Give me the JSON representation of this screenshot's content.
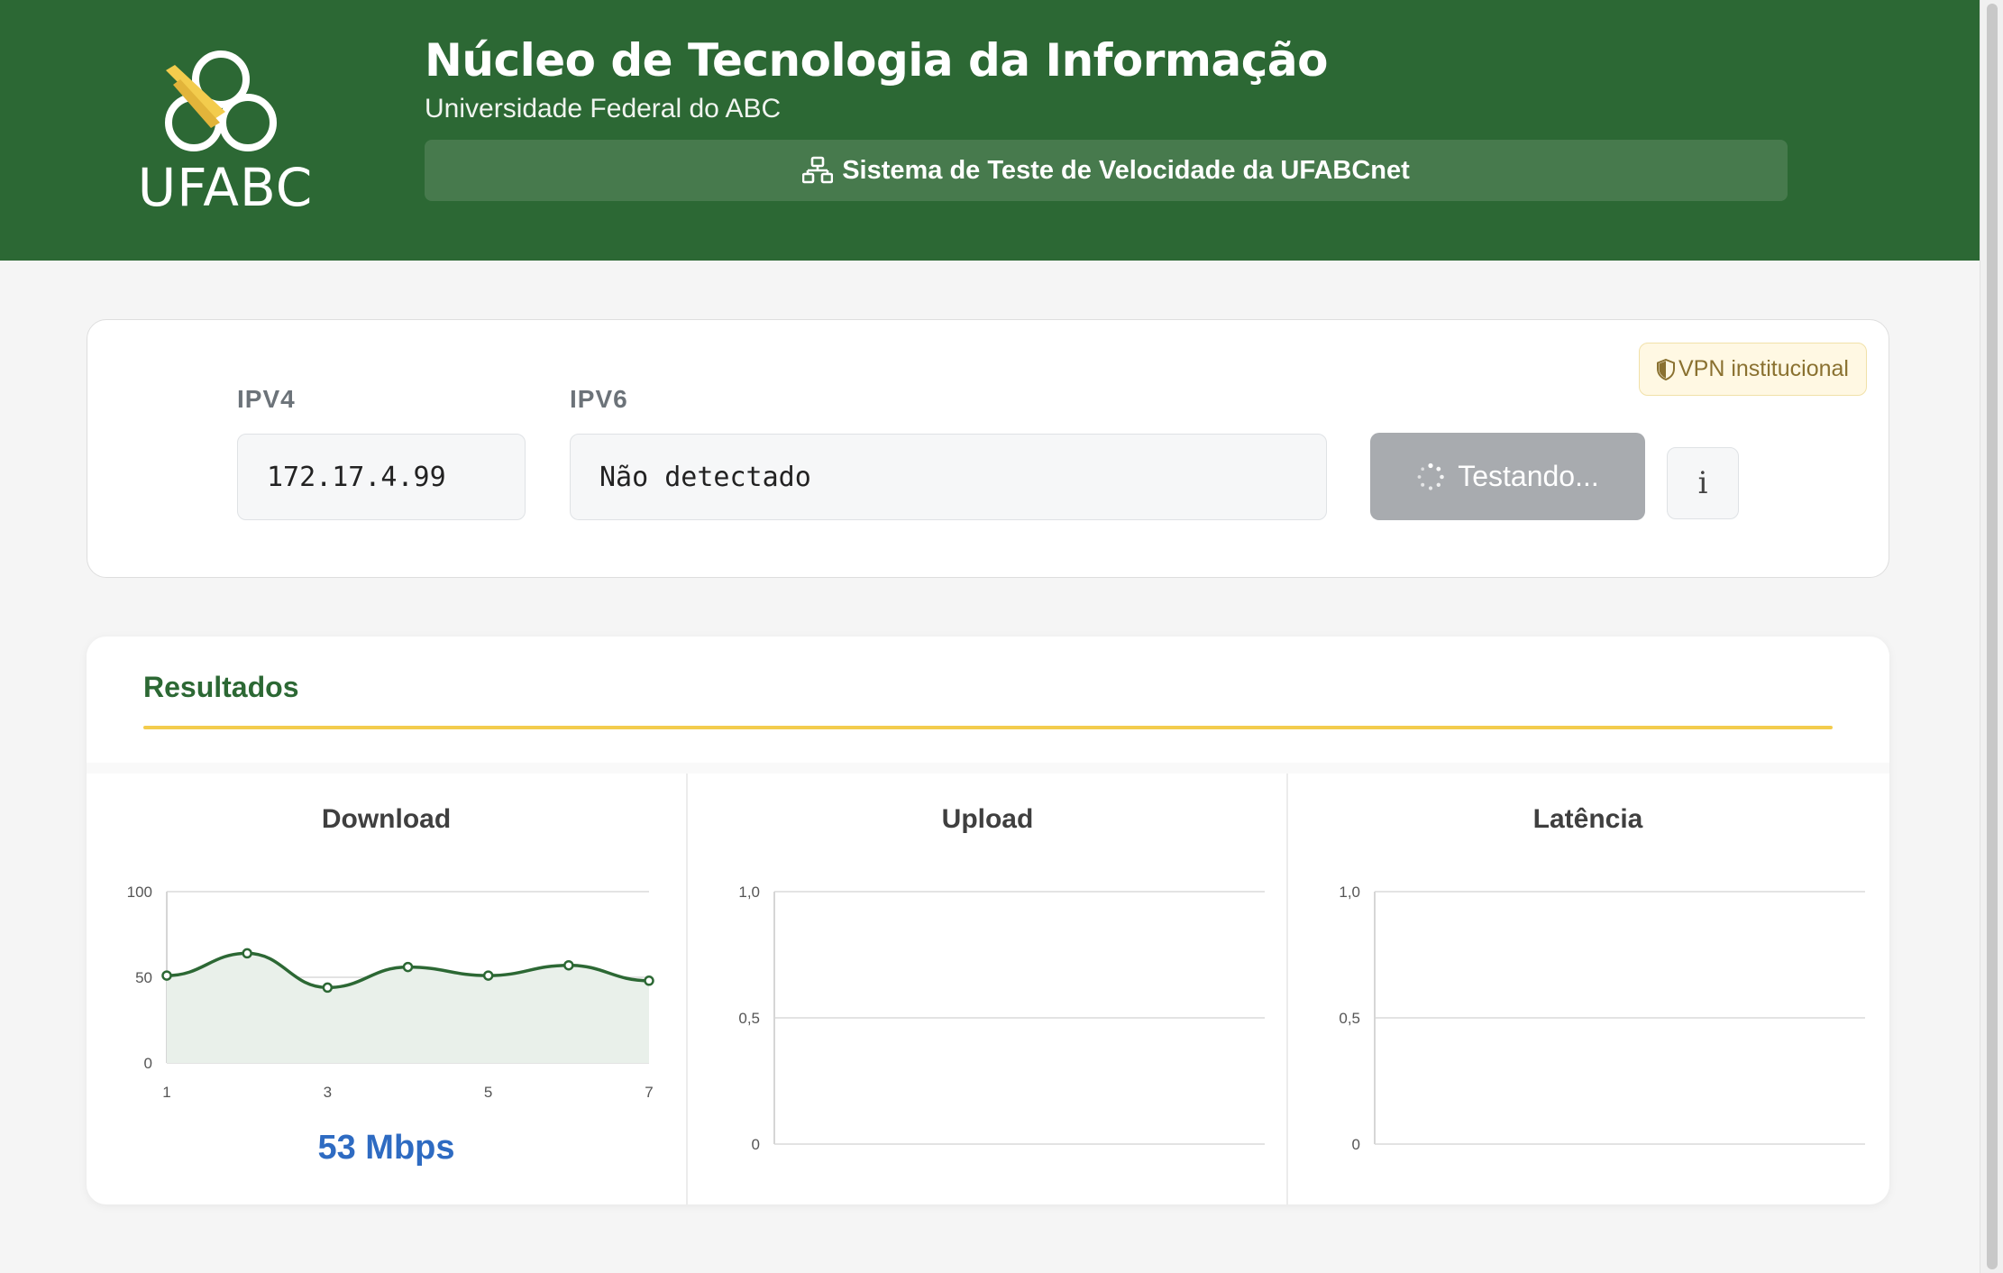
{
  "header": {
    "logo_text": "UFABC",
    "title": "Núcleo de Tecnologia da Informação",
    "subtitle": "Universidade Federal do ABC",
    "system_label": "Sistema de Teste de Velocidade da UFABCnet",
    "bg_color": "#2c6834",
    "accent_color": "#f3cc4d"
  },
  "ip_panel": {
    "ipv4_label": "IPV4",
    "ipv4_value": "172.17.4.99",
    "ipv6_label": "IPV6",
    "ipv6_value": "Não detectado",
    "test_button_label": "Testando...",
    "info_button_label": "i",
    "vpn_badge_label": "VPN institucional"
  },
  "results": {
    "title": "Resultados",
    "download": {
      "title": "Download",
      "value_label": "53 Mbps"
    },
    "upload": {
      "title": "Upload"
    },
    "latency": {
      "title": "Latência"
    }
  },
  "chart_data": [
    {
      "type": "area",
      "title": "Download",
      "x": [
        1,
        2,
        3,
        4,
        5,
        6,
        7
      ],
      "x_tick_labels": [
        "1",
        "3",
        "5",
        "7"
      ],
      "series": [
        {
          "values": [
            51,
            64,
            44,
            56,
            51,
            57,
            48
          ]
        }
      ],
      "ylim": [
        0,
        100
      ],
      "y_tick_labels": [
        "0",
        "50",
        "100"
      ],
      "grid": true,
      "line_color": "#2c6834",
      "fill_color": "#e9f0ea"
    },
    {
      "type": "line",
      "title": "Upload",
      "series": [],
      "ylim": [
        0,
        1
      ],
      "y_tick_labels": [
        "0",
        "0,5",
        "1,0"
      ],
      "grid": true
    },
    {
      "type": "line",
      "title": "Latência",
      "series": [],
      "ylim": [
        0,
        1
      ],
      "y_tick_labels": [
        "0",
        "0,5",
        "1,0"
      ],
      "grid": true
    }
  ]
}
